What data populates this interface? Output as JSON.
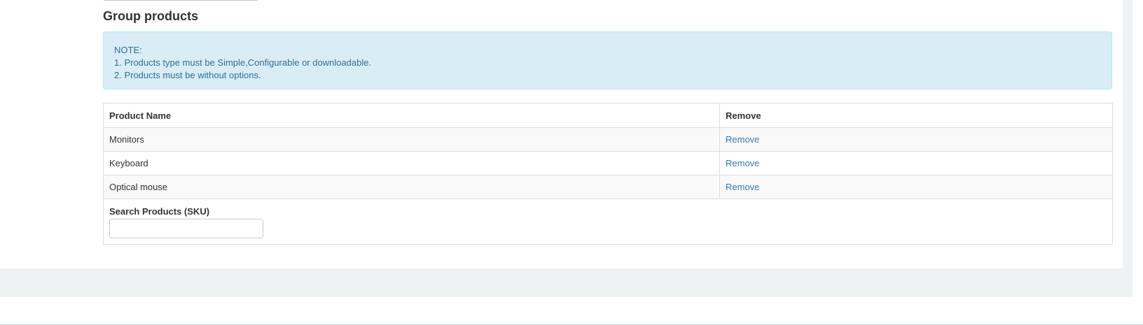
{
  "section": {
    "title": "Group products"
  },
  "note": {
    "heading": "NOTE:",
    "lines": [
      "1. Products type must be Simple,Configurable or downloadable.",
      "2. Products must be without options."
    ]
  },
  "table": {
    "headers": {
      "product_name": "Product Name",
      "remove": "Remove"
    },
    "rows": [
      {
        "name": "Monitors",
        "action": "Remove"
      },
      {
        "name": "Keyboard",
        "action": "Remove"
      },
      {
        "name": "Optical mouse",
        "action": "Remove"
      }
    ]
  },
  "search": {
    "label": "Search Products (SKU)",
    "value": "",
    "placeholder": ""
  }
}
